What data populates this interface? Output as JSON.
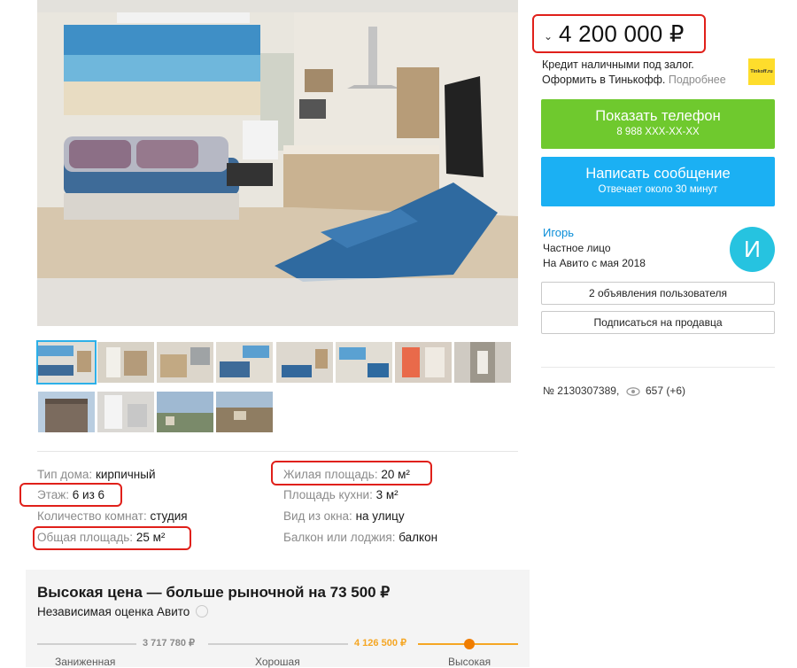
{
  "price": {
    "value": "4 200 000 ₽",
    "chevron": "⌄"
  },
  "credit": {
    "line1": "Кредит наличными под залог.",
    "line2_text": "Оформить в Тинькофф.",
    "line2_link": "Подробнее",
    "logo_text": "Tinkoff.ru",
    "logo_color": "#fedd2c"
  },
  "buttons": {
    "phone_title": "Показать телефон",
    "phone_sub": "8 988 XXX-XX-XX",
    "phone_color": "#6fc92e",
    "message_title": "Написать сообщение",
    "message_sub": "Отвечает около 30 минут",
    "message_color": "#1bb0f3"
  },
  "seller": {
    "name": "Игорь",
    "type": "Частное лицо",
    "since": "На Авито с мая 2018",
    "avatar_letter": "И",
    "avatar_color": "#26c3e0",
    "ads_button": "2 объявления пользователя",
    "subscribe_button": "Подписаться на продавца"
  },
  "meta": {
    "number": "№ 2130307389,",
    "views": "657 (+6)",
    "views_icon": "eye-icon"
  },
  "gallery": {
    "thumb_count": 12,
    "selected_index": 0
  },
  "params": [
    {
      "label": "Тип дома:",
      "value": "кирпичный"
    },
    {
      "label": "Этаж:",
      "value": "6 из 6"
    },
    {
      "label": "Количество комнат:",
      "value": "студия"
    },
    {
      "label": "Общая площадь:",
      "value": "25 м²"
    },
    {
      "label": "Жилая площадь:",
      "value": "20 м²"
    },
    {
      "label": "Площадь кухни:",
      "value": "3 м²"
    },
    {
      "label": "Вид из окна:",
      "value": "на улицу"
    },
    {
      "label": "Балкон или лоджия:",
      "value": "балкон"
    }
  ],
  "estimate": {
    "title": "Высокая цена — больше рыночной на 73 500 ₽",
    "subtitle": "Независимая оценка Авито",
    "low_value": "3 717 780 ₽",
    "high_value": "4 126 500 ₽",
    "labels": [
      "Заниженная",
      "Хорошая",
      "Высокая"
    ],
    "accent_color": "#f5a623",
    "marker_color": "#f07d00"
  },
  "highlight_color": "#e0201a"
}
